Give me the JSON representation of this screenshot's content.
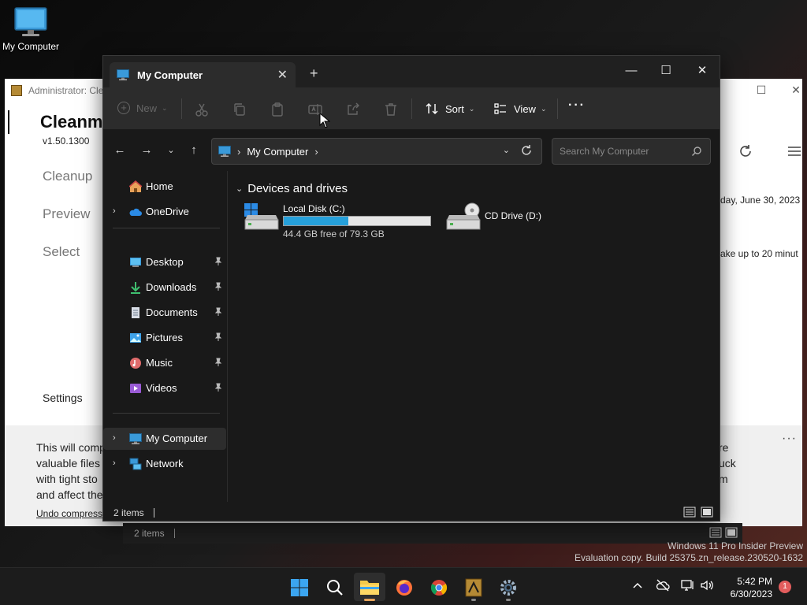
{
  "desktop": {
    "icon_label": "My Computer"
  },
  "bg_window": {
    "title": "Administrator: Cle",
    "app_title": "Cleanm",
    "version": "v1.50.1300",
    "nav": [
      "Cleanup",
      "Preview",
      "Select"
    ],
    "settings": "Settings",
    "date_text": "day, June 30, 2023",
    "take_text": "ake up to 20 minut",
    "footer_lines": [
      "This will comp",
      "valuable files",
      "with tight sto",
      "and affect the"
    ],
    "footer_right_lines": [
      "re",
      "uck",
      "m"
    ],
    "undo_link": "Undo compress",
    "more": "···"
  },
  "ghost_status": {
    "items": "2 items"
  },
  "watermark": {
    "line1": "Windows 11 Pro Insider Preview",
    "line2": "Evaluation copy. Build 25375.zn_release.230520-1632"
  },
  "explorer": {
    "tab_title": "My Computer",
    "tab_close": "✕",
    "new_tab": "+",
    "caption": {
      "minimize": "—",
      "maximize": "☐",
      "close": "✕"
    },
    "cmd": {
      "new_label": "New",
      "sort_label": "Sort",
      "view_label": "View",
      "more": "···"
    },
    "address": {
      "separator": "›",
      "location": "My Computer",
      "trail": "›"
    },
    "search_placeholder": "Search My Computer",
    "sidebar": {
      "home": "Home",
      "onedrive": "OneDrive",
      "desktop": "Desktop",
      "downloads": "Downloads",
      "documents": "Documents",
      "pictures": "Pictures",
      "music": "Music",
      "videos": "Videos",
      "mycomputer": "My Computer",
      "network": "Network"
    },
    "group_header": "Devices and drives",
    "drives": [
      {
        "name": "Local Disk (C:)",
        "free_text": "44.4 GB free of 79.3 GB",
        "used_fraction": 0.44
      },
      {
        "name": "CD Drive (D:)"
      }
    ],
    "status": {
      "items": "2 items"
    }
  },
  "taskbar": {
    "time": "5:42 PM",
    "date": "6/30/2023",
    "notif_count": "1"
  }
}
